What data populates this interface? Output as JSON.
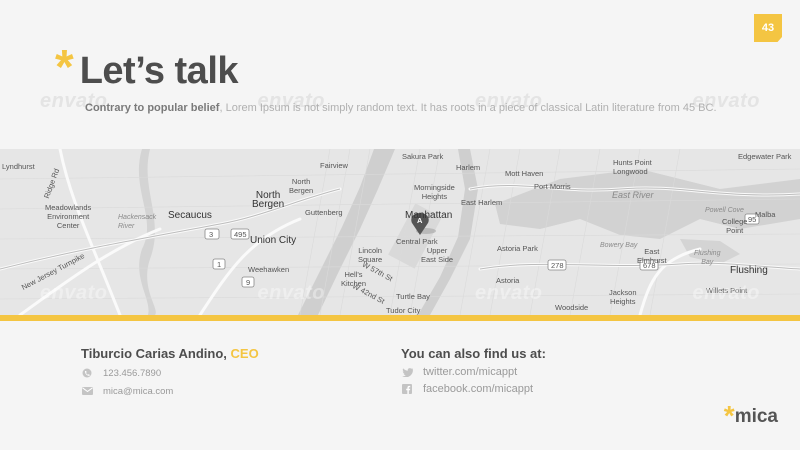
{
  "page_number": "43",
  "title": {
    "asterisk": "*",
    "text": "Let’s talk"
  },
  "subtitle": {
    "lead": "Contrary to popular belief",
    "rest": ", Lorem Ipsum is not simply random text. It has roots in a piece of classical Latin literature from 45 BC."
  },
  "watermark": [
    "envato",
    "envato",
    "envato",
    "envato"
  ],
  "map": {
    "labels": {
      "lyndhurst": "Lyndhurst",
      "meadowlands": "Meadowlands\nEnvironment\nCenter",
      "hackensack": "Hackensack\nRiver",
      "secaucus": "Secaucus",
      "fairview": "Fairview",
      "north_bergen_small": "North\nBergen",
      "north_bergen": "North\nBergen",
      "guttenberg": "Guttenberg",
      "union_city": "Union City",
      "weehawken": "Weehawken",
      "lincoln_square": "Lincoln\nSquare",
      "hells_kitchen": "Hell's\nKitchen",
      "sakura_park": "Sakura Park",
      "harlem": "Harlem",
      "morningside": "Morningside\nHeights",
      "east_harlem": "East Harlem",
      "manhattan": "Manhattan",
      "central_park": "Central Park",
      "upper_east_side": "Upper\nEast Side",
      "turtle_bay": "Turtle Bay",
      "tudor_city": "Tudor City",
      "mott_haven": "Mott Haven",
      "port_morris": "Port Morris",
      "astoria_park": "Astoria Park",
      "astoria": "Astoria",
      "hunts_point": "Hunts Point\nLongwood",
      "east_river": "East River",
      "powell_cove": "Powell Cove",
      "college_point": "College\nPoint",
      "malba": "Malba",
      "bowery_bay": "Bowery Bay",
      "flushing_bay": "Flushing\nBay",
      "east_elmhurst": "East\nElmhurst",
      "flushing": "Flushing",
      "jackson_heights": "Jackson\nHeights",
      "woodside": "Woodside",
      "willets_point": "Willets Point",
      "edgewater_park": "Edgewater Park",
      "ridge_rd": "Ridge Rd",
      "new_jersey_tpke": "New Jersey Turnpike",
      "w57": "W 57th St",
      "w42": "W 42nd St",
      "r3": "3",
      "r495": "495",
      "r1": "1",
      "r9": "9",
      "r278": "278",
      "r678": "678",
      "r95": "95",
      "pin": "A"
    }
  },
  "contact": {
    "name": "Tiburcio Carias Andino, ",
    "role": "CEO",
    "phone": "123.456.7890",
    "email": "mica@mica.com",
    "social_heading": "You can also find us at:",
    "twitter": "twitter.com/micappt",
    "facebook": "facebook.com/micappt"
  },
  "logo": {
    "star": "*",
    "text": "mica"
  },
  "colors": {
    "accent": "#f4c542",
    "title": "#4d4d4d",
    "muted": "#9a9a9a",
    "background": "#f5f5f5"
  }
}
